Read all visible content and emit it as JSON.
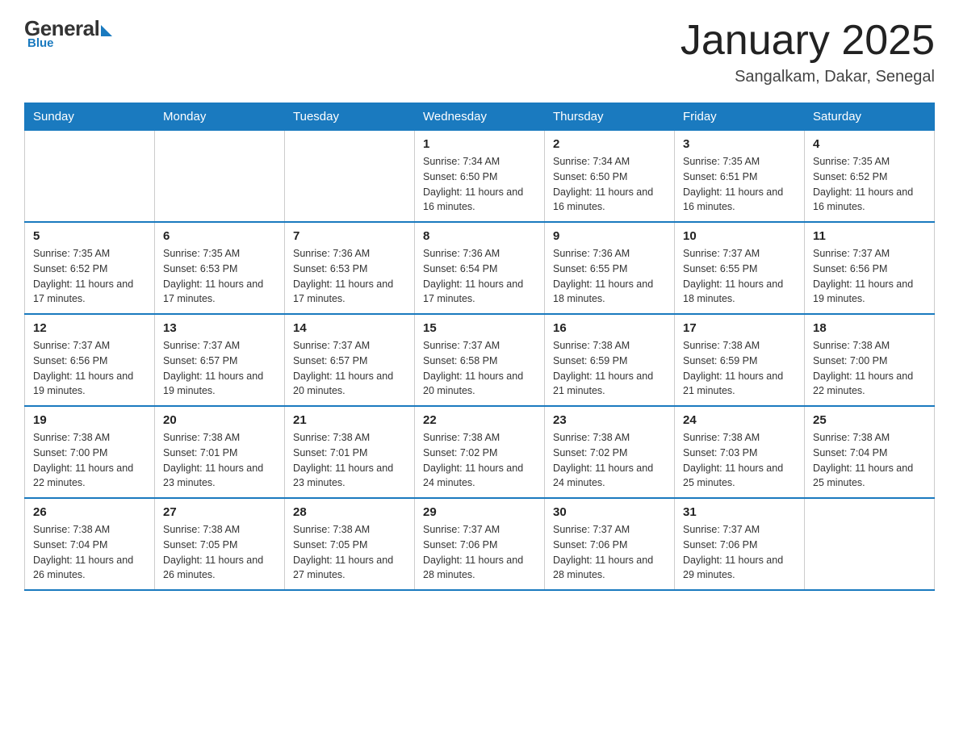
{
  "logo": {
    "general": "General",
    "blue": "Blue",
    "tagline": "Blue"
  },
  "title": "January 2025",
  "location": "Sangalkam, Dakar, Senegal",
  "days_of_week": [
    "Sunday",
    "Monday",
    "Tuesday",
    "Wednesday",
    "Thursday",
    "Friday",
    "Saturday"
  ],
  "weeks": [
    [
      {
        "day": "",
        "info": ""
      },
      {
        "day": "",
        "info": ""
      },
      {
        "day": "",
        "info": ""
      },
      {
        "day": "1",
        "info": "Sunrise: 7:34 AM\nSunset: 6:50 PM\nDaylight: 11 hours and 16 minutes."
      },
      {
        "day": "2",
        "info": "Sunrise: 7:34 AM\nSunset: 6:50 PM\nDaylight: 11 hours and 16 minutes."
      },
      {
        "day": "3",
        "info": "Sunrise: 7:35 AM\nSunset: 6:51 PM\nDaylight: 11 hours and 16 minutes."
      },
      {
        "day": "4",
        "info": "Sunrise: 7:35 AM\nSunset: 6:52 PM\nDaylight: 11 hours and 16 minutes."
      }
    ],
    [
      {
        "day": "5",
        "info": "Sunrise: 7:35 AM\nSunset: 6:52 PM\nDaylight: 11 hours and 17 minutes."
      },
      {
        "day": "6",
        "info": "Sunrise: 7:35 AM\nSunset: 6:53 PM\nDaylight: 11 hours and 17 minutes."
      },
      {
        "day": "7",
        "info": "Sunrise: 7:36 AM\nSunset: 6:53 PM\nDaylight: 11 hours and 17 minutes."
      },
      {
        "day": "8",
        "info": "Sunrise: 7:36 AM\nSunset: 6:54 PM\nDaylight: 11 hours and 17 minutes."
      },
      {
        "day": "9",
        "info": "Sunrise: 7:36 AM\nSunset: 6:55 PM\nDaylight: 11 hours and 18 minutes."
      },
      {
        "day": "10",
        "info": "Sunrise: 7:37 AM\nSunset: 6:55 PM\nDaylight: 11 hours and 18 minutes."
      },
      {
        "day": "11",
        "info": "Sunrise: 7:37 AM\nSunset: 6:56 PM\nDaylight: 11 hours and 19 minutes."
      }
    ],
    [
      {
        "day": "12",
        "info": "Sunrise: 7:37 AM\nSunset: 6:56 PM\nDaylight: 11 hours and 19 minutes."
      },
      {
        "day": "13",
        "info": "Sunrise: 7:37 AM\nSunset: 6:57 PM\nDaylight: 11 hours and 19 minutes."
      },
      {
        "day": "14",
        "info": "Sunrise: 7:37 AM\nSunset: 6:57 PM\nDaylight: 11 hours and 20 minutes."
      },
      {
        "day": "15",
        "info": "Sunrise: 7:37 AM\nSunset: 6:58 PM\nDaylight: 11 hours and 20 minutes."
      },
      {
        "day": "16",
        "info": "Sunrise: 7:38 AM\nSunset: 6:59 PM\nDaylight: 11 hours and 21 minutes."
      },
      {
        "day": "17",
        "info": "Sunrise: 7:38 AM\nSunset: 6:59 PM\nDaylight: 11 hours and 21 minutes."
      },
      {
        "day": "18",
        "info": "Sunrise: 7:38 AM\nSunset: 7:00 PM\nDaylight: 11 hours and 22 minutes."
      }
    ],
    [
      {
        "day": "19",
        "info": "Sunrise: 7:38 AM\nSunset: 7:00 PM\nDaylight: 11 hours and 22 minutes."
      },
      {
        "day": "20",
        "info": "Sunrise: 7:38 AM\nSunset: 7:01 PM\nDaylight: 11 hours and 23 minutes."
      },
      {
        "day": "21",
        "info": "Sunrise: 7:38 AM\nSunset: 7:01 PM\nDaylight: 11 hours and 23 minutes."
      },
      {
        "day": "22",
        "info": "Sunrise: 7:38 AM\nSunset: 7:02 PM\nDaylight: 11 hours and 24 minutes."
      },
      {
        "day": "23",
        "info": "Sunrise: 7:38 AM\nSunset: 7:02 PM\nDaylight: 11 hours and 24 minutes."
      },
      {
        "day": "24",
        "info": "Sunrise: 7:38 AM\nSunset: 7:03 PM\nDaylight: 11 hours and 25 minutes."
      },
      {
        "day": "25",
        "info": "Sunrise: 7:38 AM\nSunset: 7:04 PM\nDaylight: 11 hours and 25 minutes."
      }
    ],
    [
      {
        "day": "26",
        "info": "Sunrise: 7:38 AM\nSunset: 7:04 PM\nDaylight: 11 hours and 26 minutes."
      },
      {
        "day": "27",
        "info": "Sunrise: 7:38 AM\nSunset: 7:05 PM\nDaylight: 11 hours and 26 minutes."
      },
      {
        "day": "28",
        "info": "Sunrise: 7:38 AM\nSunset: 7:05 PM\nDaylight: 11 hours and 27 minutes."
      },
      {
        "day": "29",
        "info": "Sunrise: 7:37 AM\nSunset: 7:06 PM\nDaylight: 11 hours and 28 minutes."
      },
      {
        "day": "30",
        "info": "Sunrise: 7:37 AM\nSunset: 7:06 PM\nDaylight: 11 hours and 28 minutes."
      },
      {
        "day": "31",
        "info": "Sunrise: 7:37 AM\nSunset: 7:06 PM\nDaylight: 11 hours and 29 minutes."
      },
      {
        "day": "",
        "info": ""
      }
    ]
  ]
}
